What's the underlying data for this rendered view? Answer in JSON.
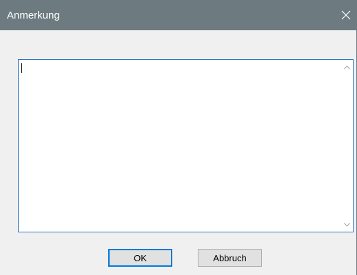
{
  "dialog": {
    "title": "Anmerkung",
    "note_value": ""
  },
  "buttons": {
    "ok_label": "OK",
    "cancel_label": "Abbruch"
  },
  "icons": {
    "close": "close-icon",
    "scroll_up": "chevron-up-icon",
    "scroll_down": "chevron-down-icon"
  },
  "colors": {
    "titlebar": "#6d7b80",
    "focus_border": "#2d73c4",
    "default_button_border": "#0078d7"
  }
}
